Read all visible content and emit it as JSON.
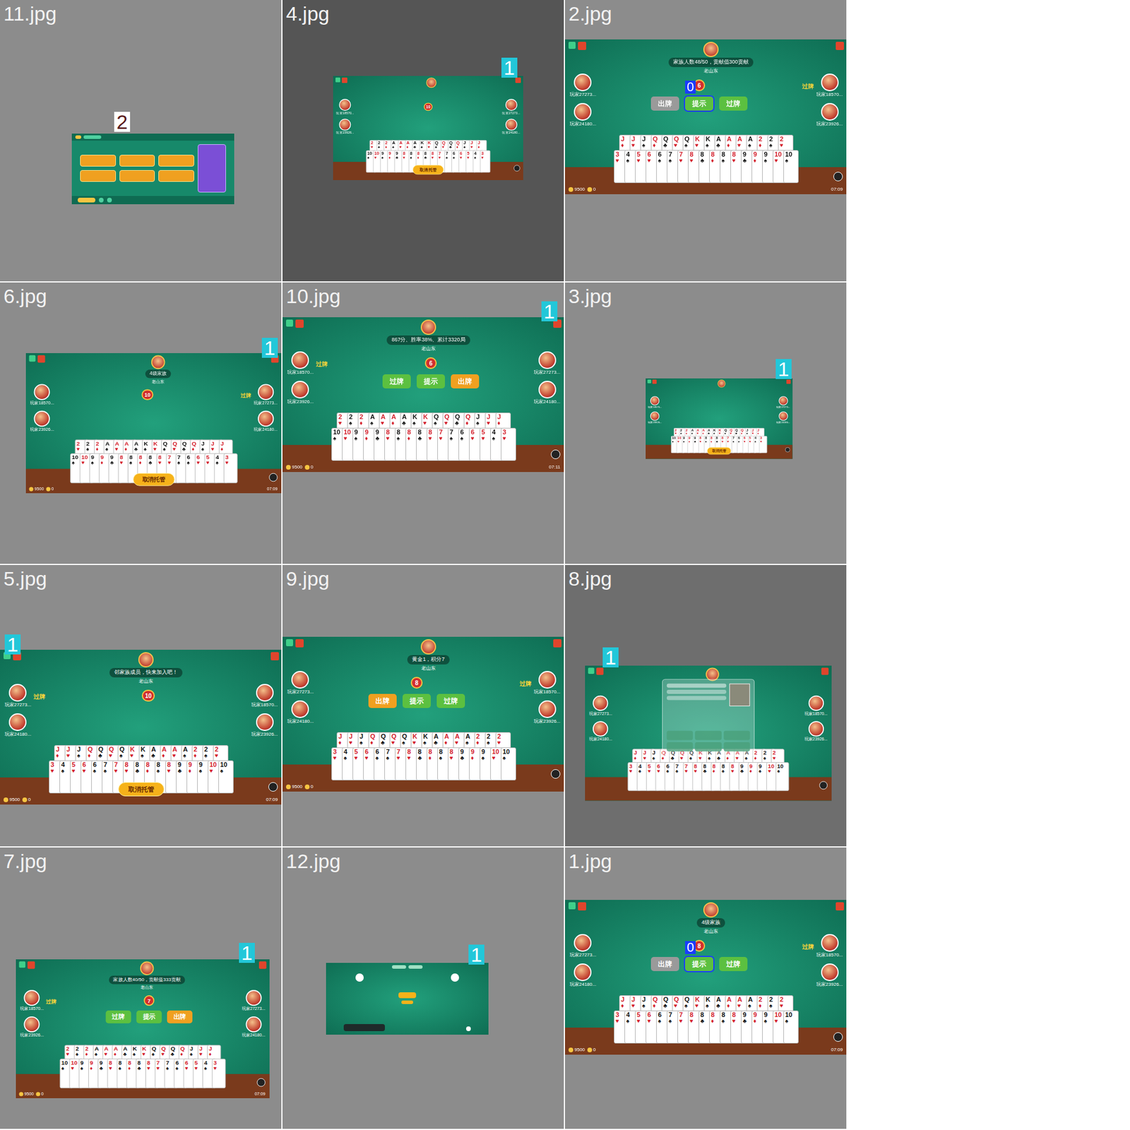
{
  "hand": {
    "top": [
      {
        "rank": "2",
        "suit": "♥"
      },
      {
        "rank": "2",
        "suit": "♠"
      },
      {
        "rank": "2",
        "suit": "♦"
      },
      {
        "rank": "A",
        "suit": "♠"
      },
      {
        "rank": "A",
        "suit": "♥"
      },
      {
        "rank": "A",
        "suit": "♦"
      },
      {
        "rank": "A",
        "suit": "♣"
      },
      {
        "rank": "K",
        "suit": "♠"
      },
      {
        "rank": "K",
        "suit": "♥"
      },
      {
        "rank": "Q",
        "suit": "♠"
      },
      {
        "rank": "Q",
        "suit": "♥"
      },
      {
        "rank": "Q",
        "suit": "♣"
      },
      {
        "rank": "Q",
        "suit": "♦"
      },
      {
        "rank": "J",
        "suit": "♠"
      },
      {
        "rank": "J",
        "suit": "♥"
      },
      {
        "rank": "J",
        "suit": "♦"
      }
    ],
    "bottom": [
      {
        "rank": "10",
        "suit": "♠"
      },
      {
        "rank": "10",
        "suit": "♥"
      },
      {
        "rank": "9",
        "suit": "♠"
      },
      {
        "rank": "9",
        "suit": "♦"
      },
      {
        "rank": "9",
        "suit": "♣"
      },
      {
        "rank": "8",
        "suit": "♥"
      },
      {
        "rank": "8",
        "suit": "♠"
      },
      {
        "rank": "8",
        "suit": "♦"
      },
      {
        "rank": "8",
        "suit": "♣"
      },
      {
        "rank": "8",
        "suit": "♥"
      },
      {
        "rank": "7",
        "suit": "♥"
      },
      {
        "rank": "7",
        "suit": "♠"
      },
      {
        "rank": "6",
        "suit": "♠"
      },
      {
        "rank": "6",
        "suit": "♥"
      },
      {
        "rank": "5",
        "suit": "♥"
      },
      {
        "rank": "4",
        "suit": "♠"
      },
      {
        "rank": "3",
        "suit": "♥"
      }
    ]
  },
  "tiles": [
    {
      "file": "11.jpg",
      "kind": "lobby",
      "badge": {
        "text": "2",
        "color": "#ffffff"
      }
    },
    {
      "file": "4.jpg",
      "kind": "table",
      "mirrored": false,
      "badge": {
        "text": "1",
        "color": "#22c7d9"
      },
      "counter": "10",
      "auto_button": "取消托管",
      "players": [
        {
          "name": "玩家18570...",
          "side": "left",
          "passed": false
        },
        {
          "name": "玩家23926...",
          "side": "left",
          "passed": false
        },
        {
          "name": "玩家27273...",
          "side": "right",
          "passed": false
        },
        {
          "name": "玩家24180...",
          "side": "right",
          "passed": false
        }
      ]
    },
    {
      "file": "2.jpg",
      "kind": "table",
      "mirrored": true,
      "header": "家族人数48/50，贡献值300贡献",
      "subname": "老山东",
      "counter": "6",
      "buttons": [
        {
          "label": "出牌",
          "color": "#9a9a9a",
          "selected": false
        },
        {
          "label": "提示",
          "color": "#5cc040",
          "selected": true,
          "badge": "0"
        },
        {
          "label": "过牌",
          "color": "#5cc040",
          "selected": false
        }
      ],
      "pass_label": "过牌",
      "players": [
        {
          "name": "玩家27273...",
          "side": "left",
          "passed": false
        },
        {
          "name": "玩家24180...",
          "side": "left",
          "passed": false
        },
        {
          "name": "玩家18570...",
          "side": "right",
          "passed": true
        },
        {
          "name": "玩家23926...",
          "side": "right",
          "passed": false
        }
      ],
      "time": "07:09",
      "coins": [
        "9500",
        "0"
      ]
    },
    {
      "file": "6.jpg",
      "kind": "table",
      "mirrored": false,
      "badge": {
        "text": "1",
        "color": "#22c7d9"
      },
      "header": "4级家族",
      "subname": "老山东",
      "counter": "10",
      "auto_button": "取消托管",
      "pass_label": "过牌",
      "players": [
        {
          "name": "玩家18570...",
          "side": "left",
          "passed": false
        },
        {
          "name": "玩家23926...",
          "side": "left",
          "passed": false
        },
        {
          "name": "玩家27273...",
          "side": "right",
          "passed": true
        },
        {
          "name": "玩家24180...",
          "side": "right",
          "passed": false
        }
      ],
      "time": "07:09",
      "coins": [
        "9500",
        "0"
      ]
    },
    {
      "file": "10.jpg",
      "kind": "table",
      "mirrored": false,
      "badge": {
        "text": "1",
        "color": "#22c7d9"
      },
      "header": "867分、胜率38%、累计3320局",
      "subname": "老山东",
      "counter": "6",
      "buttons": [
        {
          "label": "过牌",
          "color": "#5cc040",
          "selected": false
        },
        {
          "label": "提示",
          "color": "#5cc040",
          "selected": false
        },
        {
          "label": "出牌",
          "color": "#f0a020",
          "selected": false
        }
      ],
      "pass_label": "过牌",
      "players": [
        {
          "name": "玩家18570...",
          "side": "left",
          "passed": true
        },
        {
          "name": "玩家23926...",
          "side": "left",
          "passed": false
        },
        {
          "name": "玩家27273...",
          "side": "right",
          "passed": false
        },
        {
          "name": "玩家24180...",
          "side": "right",
          "passed": false
        }
      ],
      "time": "07:11",
      "coins": [
        "9500",
        "0"
      ]
    },
    {
      "file": "3.jpg",
      "kind": "table",
      "mirrored": false,
      "badge": {
        "text": "1",
        "color": "#22c7d9"
      },
      "auto_button": "取消托管",
      "players": [
        {
          "name": "玩家18570...",
          "side": "left",
          "passed": false
        },
        {
          "name": "玩家23926...",
          "side": "left",
          "passed": false
        },
        {
          "name": "玩家27273...",
          "side": "right",
          "passed": false
        },
        {
          "name": "玩家24180...",
          "side": "right",
          "passed": false
        }
      ]
    },
    {
      "file": "5.jpg",
      "kind": "table",
      "mirrored": true,
      "badge": {
        "text": "1",
        "color": "#22c7d9"
      },
      "header": "邻家族成员，快来加入吧！",
      "subname": "老山东",
      "counter": "10",
      "auto_button": "取消托管",
      "pass_label": "过牌",
      "players": [
        {
          "name": "玩家27273...",
          "side": "left",
          "passed": true
        },
        {
          "name": "玩家24180...",
          "side": "left",
          "passed": false
        },
        {
          "name": "玩家18570...",
          "side": "right",
          "passed": false
        },
        {
          "name": "玩家23926...",
          "side": "right",
          "passed": false
        }
      ],
      "time": "07:09",
      "coins": [
        "9500",
        "0"
      ]
    },
    {
      "file": "9.jpg",
      "kind": "table",
      "mirrored": true,
      "header": "黄金1，积分7",
      "subname": "老山东",
      "counter": "8",
      "buttons": [
        {
          "label": "出牌",
          "color": "#f0a020",
          "selected": false
        },
        {
          "label": "提示",
          "color": "#5cc040",
          "selected": false
        },
        {
          "label": "过牌",
          "color": "#5cc040",
          "selected": false
        }
      ],
      "pass_label": "过牌",
      "players": [
        {
          "name": "玩家27273...",
          "side": "left",
          "passed": false
        },
        {
          "name": "玩家24180...",
          "side": "left",
          "passed": false
        },
        {
          "name": "玩家18570...",
          "side": "right",
          "passed": true
        },
        {
          "name": "玩家23926...",
          "side": "right",
          "passed": false
        }
      ],
      "coins": [
        "9500",
        "0"
      ]
    },
    {
      "file": "8.jpg",
      "kind": "dialog",
      "mirrored": true,
      "badge": {
        "text": "1",
        "color": "#22c7d9"
      },
      "players": [
        {
          "name": "玩家27273...",
          "side": "left",
          "passed": false
        },
        {
          "name": "玩家24180...",
          "side": "left",
          "passed": false
        },
        {
          "name": "玩家18570...",
          "side": "right",
          "passed": false
        },
        {
          "name": "玩家23926...",
          "side": "right",
          "passed": false
        }
      ]
    },
    {
      "file": "7.jpg",
      "kind": "table",
      "mirrored": false,
      "badge": {
        "text": "1",
        "color": "#22c7d9"
      },
      "header": "家族人数40/50，贡献值333贡献",
      "subname": "老山东",
      "counter": "7",
      "buttons": [
        {
          "label": "过牌",
          "color": "#5cc040",
          "selected": false
        },
        {
          "label": "提示",
          "color": "#5cc040",
          "selected": false
        },
        {
          "label": "出牌",
          "color": "#f0a020",
          "selected": false
        }
      ],
      "pass_label": "过牌",
      "players": [
        {
          "name": "玩家18570...",
          "side": "left",
          "passed": true
        },
        {
          "name": "玩家23926...",
          "side": "left",
          "passed": false
        },
        {
          "name": "玩家27273...",
          "side": "right",
          "passed": false
        },
        {
          "name": "玩家24180...",
          "side": "right",
          "passed": false
        }
      ],
      "time": "07:09",
      "coins": [
        "9500",
        "0"
      ]
    },
    {
      "file": "12.jpg",
      "kind": "waiting",
      "badge": {
        "text": "1",
        "color": "#22c7d9"
      }
    },
    {
      "file": "1.jpg",
      "kind": "table",
      "mirrored": true,
      "header": "4级家族",
      "subname": "老山东",
      "counter": "8",
      "buttons": [
        {
          "label": "出牌",
          "color": "#9a9a9a",
          "selected": false
        },
        {
          "label": "提示",
          "color": "#5cc040",
          "selected": true,
          "badge": "0"
        },
        {
          "label": "过牌",
          "color": "#5cc040",
          "selected": false
        }
      ],
      "pass_label": "过牌",
      "players": [
        {
          "name": "玩家27273...",
          "side": "left",
          "passed": false
        },
        {
          "name": "玩家24180...",
          "side": "left",
          "passed": false
        },
        {
          "name": "玩家18570...",
          "side": "right",
          "passed": true
        },
        {
          "name": "玩家23926...",
          "side": "right",
          "passed": false
        }
      ],
      "time": "07:09",
      "coins": [
        "9500",
        "0"
      ]
    }
  ]
}
